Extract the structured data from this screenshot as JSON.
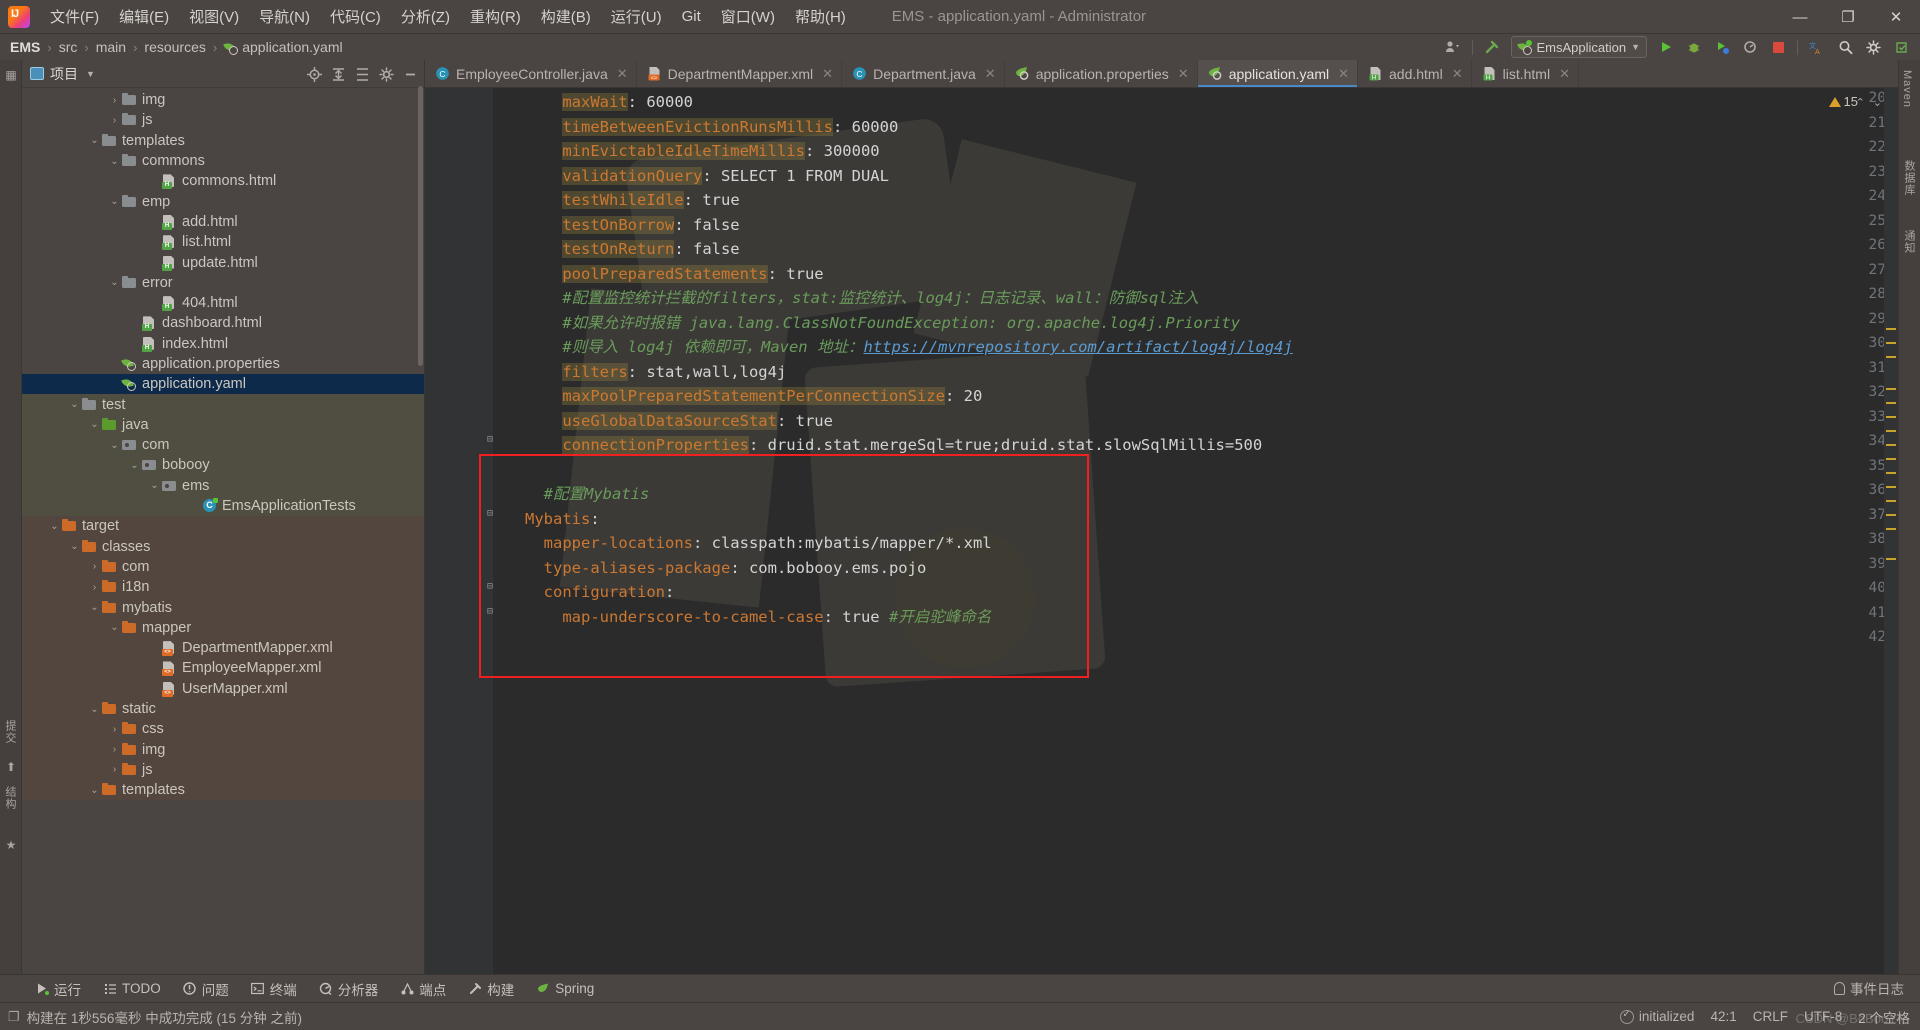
{
  "window": {
    "title": "EMS - application.yaml - Administrator",
    "minimize": "—",
    "maximize": "❐",
    "close": "✕"
  },
  "menu": {
    "items": [
      {
        "label": "文件(F)"
      },
      {
        "label": "编辑(E)"
      },
      {
        "label": "视图(V)"
      },
      {
        "label": "导航(N)"
      },
      {
        "label": "代码(C)"
      },
      {
        "label": "分析(Z)"
      },
      {
        "label": "重构(R)"
      },
      {
        "label": "构建(B)"
      },
      {
        "label": "运行(U)"
      },
      {
        "label": "Git"
      },
      {
        "label": "窗口(W)"
      },
      {
        "label": "帮助(H)"
      }
    ]
  },
  "breadcrumb": {
    "items": [
      "EMS",
      "src",
      "main",
      "resources",
      "application.yaml"
    ],
    "separator": "›"
  },
  "navbar_right": {
    "run_config": "EmsApplication",
    "icons": [
      "user-dropdown-icon",
      "hammer-icon",
      "run-icon",
      "debug-icon",
      "run-with-coverage-icon",
      "profiler-icon",
      "stop-icon",
      "translate-icon",
      "search-icon",
      "settings-icon",
      "updates-icon"
    ]
  },
  "project_panel": {
    "title": "项目",
    "header_icons": [
      "locate-icon",
      "expand-all-icon",
      "collapse-all-icon",
      "settings-icon",
      "hide-icon"
    ],
    "tree": [
      {
        "label": "img",
        "indent": 4,
        "arrow": "›",
        "icon": "folder"
      },
      {
        "label": "js",
        "indent": 4,
        "arrow": "›",
        "icon": "folder"
      },
      {
        "label": "templates",
        "indent": 3,
        "arrow": "⌄",
        "icon": "folder"
      },
      {
        "label": "commons",
        "indent": 4,
        "arrow": "⌄",
        "icon": "folder"
      },
      {
        "label": "commons.html",
        "indent": 6,
        "arrow": "",
        "icon": "html"
      },
      {
        "label": "emp",
        "indent": 4,
        "arrow": "⌄",
        "icon": "folder"
      },
      {
        "label": "add.html",
        "indent": 6,
        "arrow": "",
        "icon": "html"
      },
      {
        "label": "list.html",
        "indent": 6,
        "arrow": "",
        "icon": "html"
      },
      {
        "label": "update.html",
        "indent": 6,
        "arrow": "",
        "icon": "html"
      },
      {
        "label": "error",
        "indent": 4,
        "arrow": "⌄",
        "icon": "folder"
      },
      {
        "label": "404.html",
        "indent": 6,
        "arrow": "",
        "icon": "html"
      },
      {
        "label": "dashboard.html",
        "indent": 5,
        "arrow": "",
        "icon": "html"
      },
      {
        "label": "index.html",
        "indent": 5,
        "arrow": "",
        "icon": "html"
      },
      {
        "label": "application.properties",
        "indent": 4,
        "arrow": "",
        "icon": "spring"
      },
      {
        "label": "application.yaml",
        "indent": 4,
        "arrow": "",
        "icon": "spring",
        "selected": true
      },
      {
        "label": "test",
        "indent": 2,
        "arrow": "⌄",
        "icon": "folder",
        "tint": "test"
      },
      {
        "label": "java",
        "indent": 3,
        "arrow": "⌄",
        "icon": "folder-green",
        "tint": "test"
      },
      {
        "label": "com",
        "indent": 4,
        "arrow": "⌄",
        "icon": "pkg",
        "tint": "test"
      },
      {
        "label": "bobooy",
        "indent": 5,
        "arrow": "⌄",
        "icon": "pkg",
        "tint": "test"
      },
      {
        "label": "ems",
        "indent": 6,
        "arrow": "⌄",
        "icon": "pkg",
        "tint": "test"
      },
      {
        "label": "EmsApplicationTests",
        "indent": 8,
        "arrow": "",
        "icon": "class-test",
        "tint": "test"
      },
      {
        "label": "target",
        "indent": 1,
        "arrow": "⌄",
        "icon": "folder-orange",
        "tint": "target"
      },
      {
        "label": "classes",
        "indent": 2,
        "arrow": "⌄",
        "icon": "folder-orange",
        "tint": "target"
      },
      {
        "label": "com",
        "indent": 3,
        "arrow": "›",
        "icon": "folder-orange",
        "tint": "target"
      },
      {
        "label": "i18n",
        "indent": 3,
        "arrow": "›",
        "icon": "folder-orange",
        "tint": "target"
      },
      {
        "label": "mybatis",
        "indent": 3,
        "arrow": "⌄",
        "icon": "folder-orange",
        "tint": "target"
      },
      {
        "label": "mapper",
        "indent": 4,
        "arrow": "⌄",
        "icon": "folder-orange",
        "tint": "target"
      },
      {
        "label": "DepartmentMapper.xml",
        "indent": 6,
        "arrow": "",
        "icon": "xml",
        "tint": "target"
      },
      {
        "label": "EmployeeMapper.xml",
        "indent": 6,
        "arrow": "",
        "icon": "xml",
        "tint": "target"
      },
      {
        "label": "UserMapper.xml",
        "indent": 6,
        "arrow": "",
        "icon": "xml",
        "tint": "target"
      },
      {
        "label": "static",
        "indent": 3,
        "arrow": "⌄",
        "icon": "folder-orange",
        "tint": "target"
      },
      {
        "label": "css",
        "indent": 4,
        "arrow": "›",
        "icon": "folder-orange",
        "tint": "target"
      },
      {
        "label": "img",
        "indent": 4,
        "arrow": "›",
        "icon": "folder-orange",
        "tint": "target"
      },
      {
        "label": "js",
        "indent": 4,
        "arrow": "›",
        "icon": "folder-orange",
        "tint": "target"
      },
      {
        "label": "templates",
        "indent": 3,
        "arrow": "⌄",
        "icon": "folder-orange",
        "tint": "target"
      }
    ]
  },
  "editor": {
    "tabs": [
      {
        "label": "EmployeeController.java",
        "icon": "java-class-icon",
        "close": "✕",
        "active": false
      },
      {
        "label": "DepartmentMapper.xml",
        "icon": "xml-file-icon",
        "close": "✕",
        "active": false
      },
      {
        "label": "Department.java",
        "icon": "java-class-icon",
        "close": "✕",
        "active": false
      },
      {
        "label": "application.properties",
        "icon": "spring-file-icon",
        "close": "✕",
        "active": false
      },
      {
        "label": "application.yaml",
        "icon": "spring-file-icon",
        "close": "✕",
        "active": true
      },
      {
        "label": "add.html",
        "icon": "html-file-icon",
        "close": "✕",
        "active": false
      },
      {
        "label": "list.html",
        "icon": "html-file-icon",
        "close": "✕",
        "active": false
      }
    ],
    "warning_count": "15",
    "lines": [
      {
        "n": "20",
        "fold": "",
        "segs": [
          {
            "t": "    ",
            "c": "v"
          },
          {
            "t": "maxWait",
            "c": "k kbg"
          },
          {
            "t": ": ",
            "c": "v"
          },
          {
            "t": "60000",
            "c": "v"
          }
        ]
      },
      {
        "n": "21",
        "fold": "",
        "segs": [
          {
            "t": "    ",
            "c": "v"
          },
          {
            "t": "timeBetweenEvictionRunsMillis",
            "c": "k kbg"
          },
          {
            "t": ": ",
            "c": "v"
          },
          {
            "t": "60000",
            "c": "v"
          }
        ]
      },
      {
        "n": "22",
        "fold": "",
        "segs": [
          {
            "t": "    ",
            "c": "v"
          },
          {
            "t": "minEvictableIdleTimeMillis",
            "c": "k kbg"
          },
          {
            "t": ": ",
            "c": "v"
          },
          {
            "t": "300000",
            "c": "v"
          }
        ]
      },
      {
        "n": "23",
        "fold": "",
        "segs": [
          {
            "t": "    ",
            "c": "v"
          },
          {
            "t": "validationQuery",
            "c": "k kbg"
          },
          {
            "t": ": SELECT 1 FROM DUAL",
            "c": "v"
          }
        ]
      },
      {
        "n": "24",
        "fold": "",
        "segs": [
          {
            "t": "    ",
            "c": "v"
          },
          {
            "t": "testWhileIdle",
            "c": "k kbg"
          },
          {
            "t": ": ",
            "c": "v"
          },
          {
            "t": "true",
            "c": "v"
          }
        ]
      },
      {
        "n": "25",
        "fold": "",
        "segs": [
          {
            "t": "    ",
            "c": "v"
          },
          {
            "t": "testOnBorrow",
            "c": "k kbg"
          },
          {
            "t": ": ",
            "c": "v"
          },
          {
            "t": "false",
            "c": "v"
          }
        ]
      },
      {
        "n": "26",
        "fold": "",
        "segs": [
          {
            "t": "    ",
            "c": "v"
          },
          {
            "t": "testOnReturn",
            "c": "k kbg"
          },
          {
            "t": ": ",
            "c": "v"
          },
          {
            "t": "false",
            "c": "v"
          }
        ]
      },
      {
        "n": "27",
        "fold": "",
        "segs": [
          {
            "t": "    ",
            "c": "v"
          },
          {
            "t": "poolPreparedStatements",
            "c": "k kbg"
          },
          {
            "t": ": ",
            "c": "v"
          },
          {
            "t": "true",
            "c": "v"
          }
        ]
      },
      {
        "n": "28",
        "fold": "",
        "segs": [
          {
            "t": "    #配置监控统计拦截的filters，stat:监控统计、log4j：日志记录、wall：防御sql注入",
            "c": "cmt"
          }
        ]
      },
      {
        "n": "29",
        "fold": "",
        "segs": [
          {
            "t": "    #如果允许时报错 java.lang.ClassNotFoundException: org.apache.log4j.Priority",
            "c": "cmt"
          }
        ]
      },
      {
        "n": "30",
        "fold": "",
        "segs": [
          {
            "t": "    #则导入 log4j 依赖即可，Maven 地址：",
            "c": "cmt"
          },
          {
            "t": "https://mvnrepository.com/artifact/log4j/log4j",
            "c": "lnk"
          }
        ]
      },
      {
        "n": "31",
        "fold": "",
        "segs": [
          {
            "t": "    ",
            "c": "v"
          },
          {
            "t": "filters",
            "c": "k kbg"
          },
          {
            "t": ": stat,wall,log4j",
            "c": "v"
          }
        ]
      },
      {
        "n": "32",
        "fold": "",
        "segs": [
          {
            "t": "    ",
            "c": "v"
          },
          {
            "t": "maxPoolPreparedStatementPerConnectionSize",
            "c": "k kbg"
          },
          {
            "t": ": ",
            "c": "v"
          },
          {
            "t": "20",
            "c": "v"
          }
        ]
      },
      {
        "n": "33",
        "fold": "",
        "segs": [
          {
            "t": "    ",
            "c": "v"
          },
          {
            "t": "useGlobalDataSourceStat",
            "c": "k kbg"
          },
          {
            "t": ": ",
            "c": "v"
          },
          {
            "t": "true",
            "c": "v"
          }
        ]
      },
      {
        "n": "34",
        "fold": "⊟",
        "segs": [
          {
            "t": "    ",
            "c": "v"
          },
          {
            "t": "connectionProperties",
            "c": "k kbg"
          },
          {
            "t": ": druid.stat.mergeSql=true;druid.stat.slowSqlMillis=500",
            "c": "v"
          }
        ]
      },
      {
        "n": "35",
        "fold": "",
        "segs": [
          {
            "t": "",
            "c": "v"
          }
        ]
      },
      {
        "n": "36",
        "fold": "",
        "segs": [
          {
            "t": "  #配置Mybatis",
            "c": "cmt"
          }
        ]
      },
      {
        "n": "37",
        "fold": "⊟",
        "segs": [
          {
            "t": "Mybatis",
            "c": "k"
          },
          {
            "t": ":",
            "c": "v"
          }
        ]
      },
      {
        "n": "38",
        "fold": "",
        "segs": [
          {
            "t": "  ",
            "c": "v"
          },
          {
            "t": "mapper-locations",
            "c": "k"
          },
          {
            "t": ": classpath:mybatis/mapper/*.xml",
            "c": "v"
          }
        ]
      },
      {
        "n": "39",
        "fold": "",
        "segs": [
          {
            "t": "  ",
            "c": "v"
          },
          {
            "t": "type-aliases-package",
            "c": "k"
          },
          {
            "t": ": com.bobooy.ems.pojo",
            "c": "v"
          }
        ]
      },
      {
        "n": "40",
        "fold": "⊟",
        "segs": [
          {
            "t": "  ",
            "c": "v"
          },
          {
            "t": "configuration",
            "c": "k"
          },
          {
            "t": ":",
            "c": "v"
          }
        ]
      },
      {
        "n": "41",
        "fold": "⊟",
        "segs": [
          {
            "t": "    ",
            "c": "v"
          },
          {
            "t": "map-underscore-to-camel-case",
            "c": "k"
          },
          {
            "t": ": ",
            "c": "v"
          },
          {
            "t": "true",
            "c": "v"
          },
          {
            "t": " #开启驼峰命名",
            "c": "cmt"
          }
        ]
      },
      {
        "n": "42",
        "fold": "",
        "segs": [
          {
            "t": "",
            "c": "v"
          }
        ]
      }
    ]
  },
  "toolwindows": {
    "items": [
      {
        "label": "运行",
        "icon": "run-icon"
      },
      {
        "label": "TODO",
        "icon": "todo-icon"
      },
      {
        "label": "问题",
        "icon": "problems-icon"
      },
      {
        "label": "终端",
        "icon": "terminal-icon"
      },
      {
        "label": "分析器",
        "icon": "profiler-icon"
      },
      {
        "label": "端点",
        "icon": "endpoints-icon"
      },
      {
        "label": "构建",
        "icon": "build-icon"
      },
      {
        "label": "Spring",
        "icon": "spring-icon"
      }
    ],
    "event_log": "事件日志"
  },
  "statusbar": {
    "build_message": "构建在 1秒556毫秒 中成功完成 (15 分钟 之前)",
    "init_status": "initialized",
    "caret_position": "42:1",
    "line_separator": "CRLF",
    "encoding": "UTF-8",
    "indent": "2 个空格",
    "watermark": "CSDN @BoBooY-"
  },
  "rails": {
    "left": [
      "项目",
      "提交",
      "结构",
      "书签"
    ],
    "right": [
      "Maven",
      "数据库",
      "通知"
    ]
  }
}
